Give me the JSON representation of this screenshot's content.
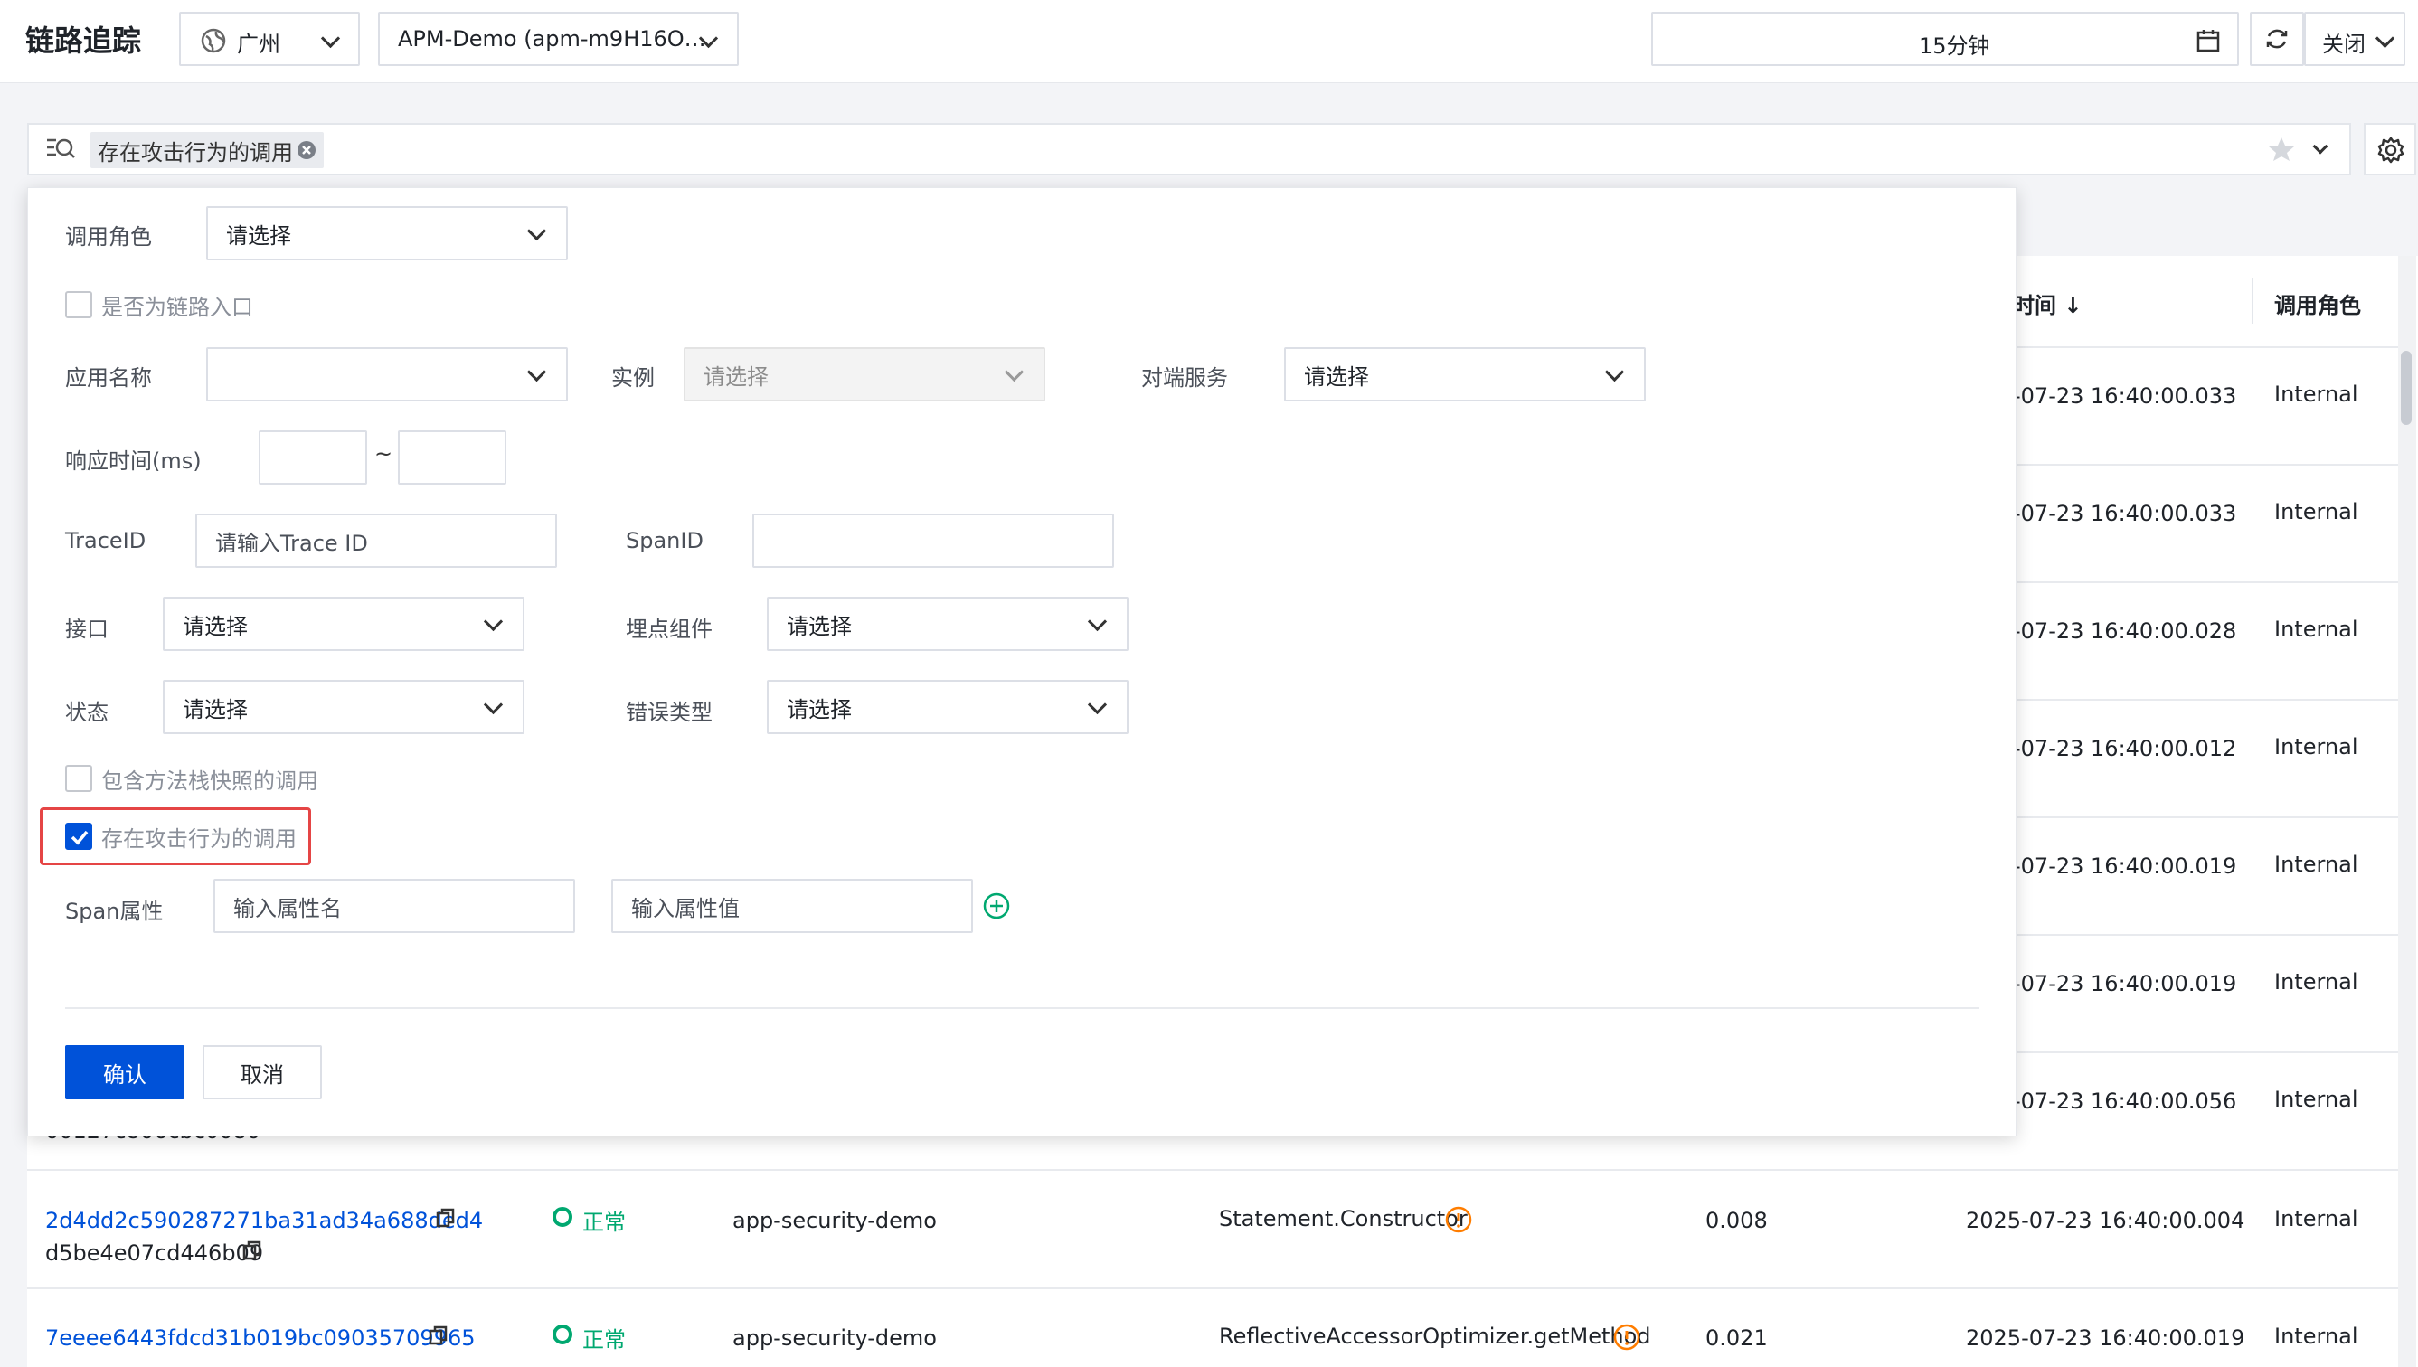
{
  "header": {
    "title": "链路追踪",
    "region": "广州",
    "instance": "APM-Demo (apm-m9H16O…",
    "time_range": "15分钟",
    "auto_refresh": "关闭"
  },
  "search": {
    "tag_label": "存在攻击行为的调用"
  },
  "table": {
    "header_time": "时间 ↓",
    "header_role": "调用角色",
    "rows": [
      {
        "time": "-07-23 16:40:00.033",
        "role": "Internal"
      },
      {
        "time": "-07-23 16:40:00.033",
        "role": "Internal"
      },
      {
        "time": "-07-23 16:40:00.028",
        "role": "Internal"
      },
      {
        "time": "-07-23 16:40:00.012",
        "role": "Internal"
      },
      {
        "time": "-07-23 16:40:00.019",
        "role": "Internal"
      },
      {
        "time": "-07-23 16:40:00.019",
        "role": "Internal"
      },
      {
        "time": "-07-23 16:40:00.056",
        "role": "Internal"
      }
    ],
    "partial_row_text": "00127c806cbc0080",
    "row8": {
      "trace_id": "2d4dd2c590287271ba31ad34a688ded4",
      "span_id": "d5be4e07cd446b09",
      "status": "正常",
      "app": "app-security-demo",
      "interface": "Statement.Constructor",
      "duration": "0.008",
      "time": "2025-07-23 16:40:00.004",
      "role": "Internal"
    },
    "row9": {
      "trace_id": "7eeee6443fdcd31b019bc09035709965",
      "status": "正常",
      "app": "app-security-demo",
      "interface": "ReflectiveAccessorOptimizer.getMethod",
      "duration": "0.021",
      "time": "2025-07-23 16:40:00.019",
      "role": "Internal"
    }
  },
  "filter": {
    "call_role_label": "调用角色",
    "call_role_value": "请选择",
    "is_entry_label": "是否为链路入口",
    "app_name_label": "应用名称",
    "app_name_value": "",
    "instance_label": "实例",
    "instance_value": "请选择",
    "peer_service_label": "对端服务",
    "peer_service_value": "请选择",
    "response_time_label": "响应时间(ms)",
    "range_sep": "~",
    "trace_id_label": "TraceID",
    "trace_id_placeholder": "请输入Trace ID",
    "span_id_label": "SpanID",
    "interface_label": "接口",
    "interface_value": "请选择",
    "component_label": "埋点组件",
    "component_value": "请选择",
    "status_label": "状态",
    "status_value": "请选择",
    "error_type_label": "错误类型",
    "error_type_value": "请选择",
    "method_stack_label": "包含方法栈快照的调用",
    "attack_label": "存在攻击行为的调用",
    "attack_checked": true,
    "span_attr_label": "Span属性",
    "attr_name_placeholder": "输入属性名",
    "attr_value_placeholder": "输入属性值",
    "confirm_label": "确认",
    "cancel_label": "取消"
  },
  "colors": {
    "primary": "#0052d9",
    "success": "#00a870",
    "warning": "#ff7d00",
    "highlight": "#e54545"
  }
}
